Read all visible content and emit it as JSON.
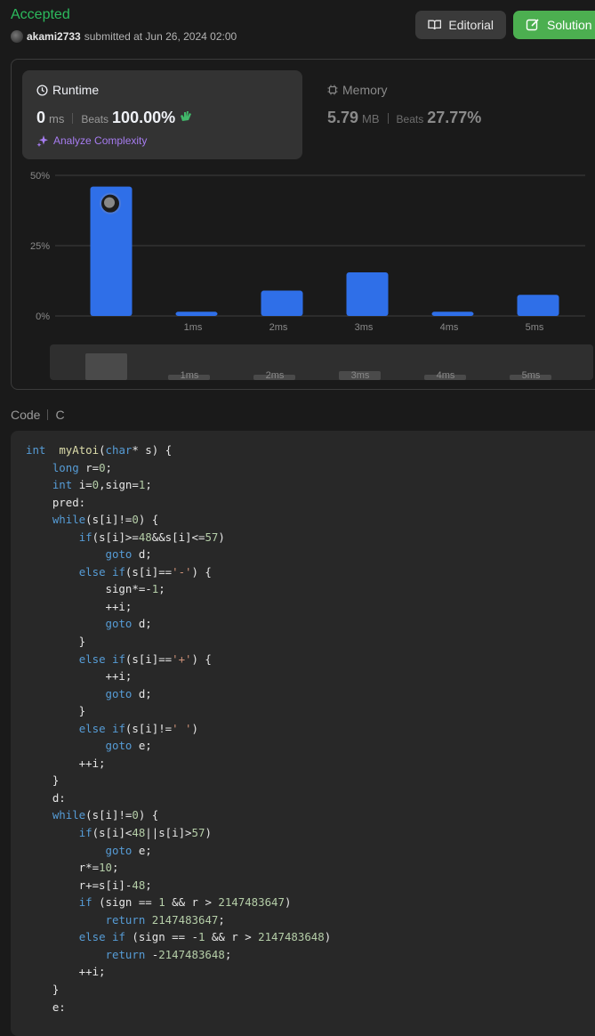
{
  "header": {
    "status": "Accepted",
    "username": "akami2733",
    "submitted_text": "submitted at Jun 26, 2024 02:00",
    "editorial_label": "Editorial",
    "solution_label": "Solution"
  },
  "runtime": {
    "title": "Runtime",
    "value": "0",
    "unit": "ms",
    "beats_label": "Beats",
    "beats_value": "100.00%",
    "analyze_label": "Analyze Complexity"
  },
  "memory": {
    "title": "Memory",
    "value": "5.79",
    "unit": "MB",
    "beats_label": "Beats",
    "beats_value": "27.77%"
  },
  "chart_data": {
    "type": "bar",
    "categories": [
      "",
      "1ms",
      "2ms",
      "3ms",
      "4ms",
      "5ms"
    ],
    "values": [
      46,
      1.5,
      9,
      15.5,
      1.5,
      7.5
    ],
    "y_ticks": [
      "0%",
      "25%",
      "50%"
    ],
    "ylim": [
      0,
      50
    ],
    "user_bar_index": 0,
    "overview_categories": [
      "",
      "1ms",
      "2ms",
      "3ms",
      "4ms",
      "5ms"
    ],
    "bar_color": "#2f6fe8"
  },
  "code_section": {
    "label": "Code",
    "language": "C"
  },
  "code_lines": [
    [
      [
        "kw",
        "int"
      ],
      [
        "",
        "  "
      ],
      [
        "fn",
        "myAtoi"
      ],
      [
        "",
        "("
      ],
      [
        "kw",
        "char"
      ],
      [
        "",
        "* s) {"
      ]
    ],
    [
      [
        "",
        "    "
      ],
      [
        "kw",
        "long"
      ],
      [
        "",
        " r="
      ],
      [
        "num",
        "0"
      ],
      [
        "",
        ";"
      ]
    ],
    [
      [
        "",
        "    "
      ],
      [
        "kw",
        "int"
      ],
      [
        "",
        " i="
      ],
      [
        "num",
        "0"
      ],
      [
        "",
        ",sign="
      ],
      [
        "num",
        "1"
      ],
      [
        "",
        ";"
      ]
    ],
    [
      [
        "",
        "    pred:"
      ]
    ],
    [
      [
        "",
        "    "
      ],
      [
        "kw",
        "while"
      ],
      [
        "",
        "(s[i]!="
      ],
      [
        "num",
        "0"
      ],
      [
        "",
        ") {"
      ]
    ],
    [
      [
        "",
        "        "
      ],
      [
        "kw",
        "if"
      ],
      [
        "",
        "(s[i]>="
      ],
      [
        "num",
        "48"
      ],
      [
        "",
        "&&s[i]<="
      ],
      [
        "num",
        "57"
      ],
      [
        "",
        ")"
      ]
    ],
    [
      [
        "",
        "            "
      ],
      [
        "kw",
        "goto"
      ],
      [
        "",
        " d;"
      ]
    ],
    [
      [
        "",
        "        "
      ],
      [
        "kw",
        "else if"
      ],
      [
        "",
        "(s[i]=="
      ],
      [
        "str",
        "'-'"
      ],
      [
        "",
        ") {"
      ]
    ],
    [
      [
        "",
        "            sign*=-"
      ],
      [
        "num",
        "1"
      ],
      [
        "",
        ";"
      ]
    ],
    [
      [
        "",
        "            ++i;"
      ]
    ],
    [
      [
        "",
        "            "
      ],
      [
        "kw",
        "goto"
      ],
      [
        "",
        " d;"
      ]
    ],
    [
      [
        "",
        "        }"
      ]
    ],
    [
      [
        "",
        "        "
      ],
      [
        "kw",
        "else if"
      ],
      [
        "",
        "(s[i]=="
      ],
      [
        "str",
        "'+'"
      ],
      [
        "",
        ") {"
      ]
    ],
    [
      [
        "",
        "            ++i;"
      ]
    ],
    [
      [
        "",
        "            "
      ],
      [
        "kw",
        "goto"
      ],
      [
        "",
        " d;"
      ]
    ],
    [
      [
        "",
        "        }"
      ]
    ],
    [
      [
        "",
        "        "
      ],
      [
        "kw",
        "else if"
      ],
      [
        "",
        "(s[i]!="
      ],
      [
        "str",
        "' '"
      ],
      [
        "",
        ")"
      ]
    ],
    [
      [
        "",
        "            "
      ],
      [
        "kw",
        "goto"
      ],
      [
        "",
        " e;"
      ]
    ],
    [
      [
        "",
        "        ++i;"
      ]
    ],
    [
      [
        "",
        "    }"
      ]
    ],
    [
      [
        "",
        "    d:"
      ]
    ],
    [
      [
        "",
        "    "
      ],
      [
        "kw",
        "while"
      ],
      [
        "",
        "(s[i]!="
      ],
      [
        "num",
        "0"
      ],
      [
        "",
        ") {"
      ]
    ],
    [
      [
        "",
        "        "
      ],
      [
        "kw",
        "if"
      ],
      [
        "",
        "(s[i]<"
      ],
      [
        "num",
        "48"
      ],
      [
        "",
        "||s[i]>"
      ],
      [
        "num",
        "57"
      ],
      [
        "",
        ")"
      ]
    ],
    [
      [
        "",
        "            "
      ],
      [
        "kw",
        "goto"
      ],
      [
        "",
        " e;"
      ]
    ],
    [
      [
        "",
        "        r*="
      ],
      [
        "num",
        "10"
      ],
      [
        "",
        ";"
      ]
    ],
    [
      [
        "",
        "        r+=s[i]-"
      ],
      [
        "num",
        "48"
      ],
      [
        "",
        ";"
      ]
    ],
    [
      [
        "",
        "        "
      ],
      [
        "kw",
        "if"
      ],
      [
        "",
        " (sign == "
      ],
      [
        "num",
        "1"
      ],
      [
        "",
        " && r > "
      ],
      [
        "num",
        "2147483647"
      ],
      [
        "",
        ")"
      ]
    ],
    [
      [
        "",
        "            "
      ],
      [
        "kw",
        "return"
      ],
      [
        "",
        " "
      ],
      [
        "num",
        "2147483647"
      ],
      [
        "",
        ";"
      ]
    ],
    [
      [
        "",
        "        "
      ],
      [
        "kw",
        "else if"
      ],
      [
        "",
        " (sign == -"
      ],
      [
        "num",
        "1"
      ],
      [
        "",
        " && r > "
      ],
      [
        "num",
        "2147483648"
      ],
      [
        "",
        ")"
      ]
    ],
    [
      [
        "",
        "            "
      ],
      [
        "kw",
        "return"
      ],
      [
        "",
        " -"
      ],
      [
        "num",
        "2147483648"
      ],
      [
        "",
        ";"
      ]
    ],
    [
      [
        "",
        "        ++i;"
      ]
    ],
    [
      [
        "",
        "    }"
      ]
    ],
    [
      [
        "",
        "    e:"
      ]
    ]
  ]
}
